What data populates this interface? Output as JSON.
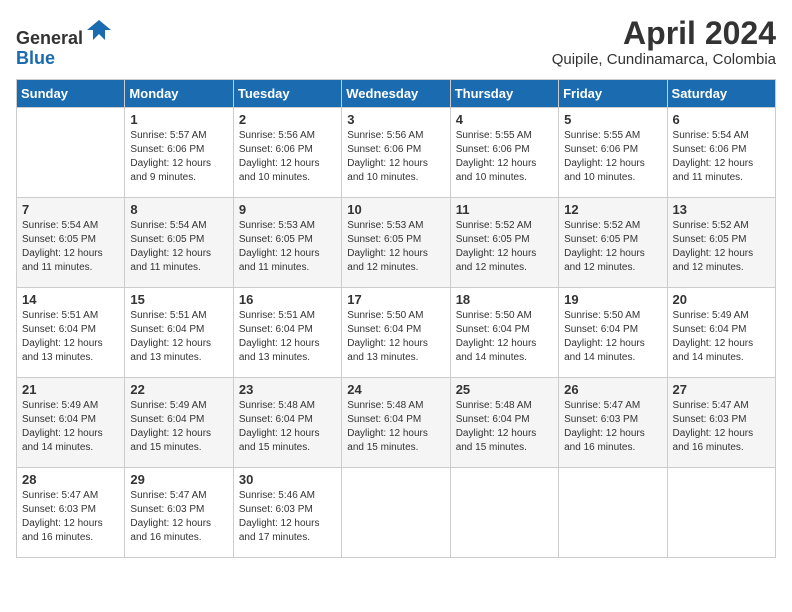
{
  "header": {
    "logo_general": "General",
    "logo_blue": "Blue",
    "month_year": "April 2024",
    "location": "Quipile, Cundinamarca, Colombia"
  },
  "days_of_week": [
    "Sunday",
    "Monday",
    "Tuesday",
    "Wednesday",
    "Thursday",
    "Friday",
    "Saturday"
  ],
  "weeks": [
    [
      {
        "day": "",
        "detail": ""
      },
      {
        "day": "1",
        "detail": "Sunrise: 5:57 AM\nSunset: 6:06 PM\nDaylight: 12 hours\nand 9 minutes."
      },
      {
        "day": "2",
        "detail": "Sunrise: 5:56 AM\nSunset: 6:06 PM\nDaylight: 12 hours\nand 10 minutes."
      },
      {
        "day": "3",
        "detail": "Sunrise: 5:56 AM\nSunset: 6:06 PM\nDaylight: 12 hours\nand 10 minutes."
      },
      {
        "day": "4",
        "detail": "Sunrise: 5:55 AM\nSunset: 6:06 PM\nDaylight: 12 hours\nand 10 minutes."
      },
      {
        "day": "5",
        "detail": "Sunrise: 5:55 AM\nSunset: 6:06 PM\nDaylight: 12 hours\nand 10 minutes."
      },
      {
        "day": "6",
        "detail": "Sunrise: 5:54 AM\nSunset: 6:06 PM\nDaylight: 12 hours\nand 11 minutes."
      }
    ],
    [
      {
        "day": "7",
        "detail": "Sunrise: 5:54 AM\nSunset: 6:05 PM\nDaylight: 12 hours\nand 11 minutes."
      },
      {
        "day": "8",
        "detail": "Sunrise: 5:54 AM\nSunset: 6:05 PM\nDaylight: 12 hours\nand 11 minutes."
      },
      {
        "day": "9",
        "detail": "Sunrise: 5:53 AM\nSunset: 6:05 PM\nDaylight: 12 hours\nand 11 minutes."
      },
      {
        "day": "10",
        "detail": "Sunrise: 5:53 AM\nSunset: 6:05 PM\nDaylight: 12 hours\nand 12 minutes."
      },
      {
        "day": "11",
        "detail": "Sunrise: 5:52 AM\nSunset: 6:05 PM\nDaylight: 12 hours\nand 12 minutes."
      },
      {
        "day": "12",
        "detail": "Sunrise: 5:52 AM\nSunset: 6:05 PM\nDaylight: 12 hours\nand 12 minutes."
      },
      {
        "day": "13",
        "detail": "Sunrise: 5:52 AM\nSunset: 6:05 PM\nDaylight: 12 hours\nand 12 minutes."
      }
    ],
    [
      {
        "day": "14",
        "detail": "Sunrise: 5:51 AM\nSunset: 6:04 PM\nDaylight: 12 hours\nand 13 minutes."
      },
      {
        "day": "15",
        "detail": "Sunrise: 5:51 AM\nSunset: 6:04 PM\nDaylight: 12 hours\nand 13 minutes."
      },
      {
        "day": "16",
        "detail": "Sunrise: 5:51 AM\nSunset: 6:04 PM\nDaylight: 12 hours\nand 13 minutes."
      },
      {
        "day": "17",
        "detail": "Sunrise: 5:50 AM\nSunset: 6:04 PM\nDaylight: 12 hours\nand 13 minutes."
      },
      {
        "day": "18",
        "detail": "Sunrise: 5:50 AM\nSunset: 6:04 PM\nDaylight: 12 hours\nand 14 minutes."
      },
      {
        "day": "19",
        "detail": "Sunrise: 5:50 AM\nSunset: 6:04 PM\nDaylight: 12 hours\nand 14 minutes."
      },
      {
        "day": "20",
        "detail": "Sunrise: 5:49 AM\nSunset: 6:04 PM\nDaylight: 12 hours\nand 14 minutes."
      }
    ],
    [
      {
        "day": "21",
        "detail": "Sunrise: 5:49 AM\nSunset: 6:04 PM\nDaylight: 12 hours\nand 14 minutes."
      },
      {
        "day": "22",
        "detail": "Sunrise: 5:49 AM\nSunset: 6:04 PM\nDaylight: 12 hours\nand 15 minutes."
      },
      {
        "day": "23",
        "detail": "Sunrise: 5:48 AM\nSunset: 6:04 PM\nDaylight: 12 hours\nand 15 minutes."
      },
      {
        "day": "24",
        "detail": "Sunrise: 5:48 AM\nSunset: 6:04 PM\nDaylight: 12 hours\nand 15 minutes."
      },
      {
        "day": "25",
        "detail": "Sunrise: 5:48 AM\nSunset: 6:04 PM\nDaylight: 12 hours\nand 15 minutes."
      },
      {
        "day": "26",
        "detail": "Sunrise: 5:47 AM\nSunset: 6:03 PM\nDaylight: 12 hours\nand 16 minutes."
      },
      {
        "day": "27",
        "detail": "Sunrise: 5:47 AM\nSunset: 6:03 PM\nDaylight: 12 hours\nand 16 minutes."
      }
    ],
    [
      {
        "day": "28",
        "detail": "Sunrise: 5:47 AM\nSunset: 6:03 PM\nDaylight: 12 hours\nand 16 minutes."
      },
      {
        "day": "29",
        "detail": "Sunrise: 5:47 AM\nSunset: 6:03 PM\nDaylight: 12 hours\nand 16 minutes."
      },
      {
        "day": "30",
        "detail": "Sunrise: 5:46 AM\nSunset: 6:03 PM\nDaylight: 12 hours\nand 17 minutes."
      },
      {
        "day": "",
        "detail": ""
      },
      {
        "day": "",
        "detail": ""
      },
      {
        "day": "",
        "detail": ""
      },
      {
        "day": "",
        "detail": ""
      }
    ]
  ]
}
